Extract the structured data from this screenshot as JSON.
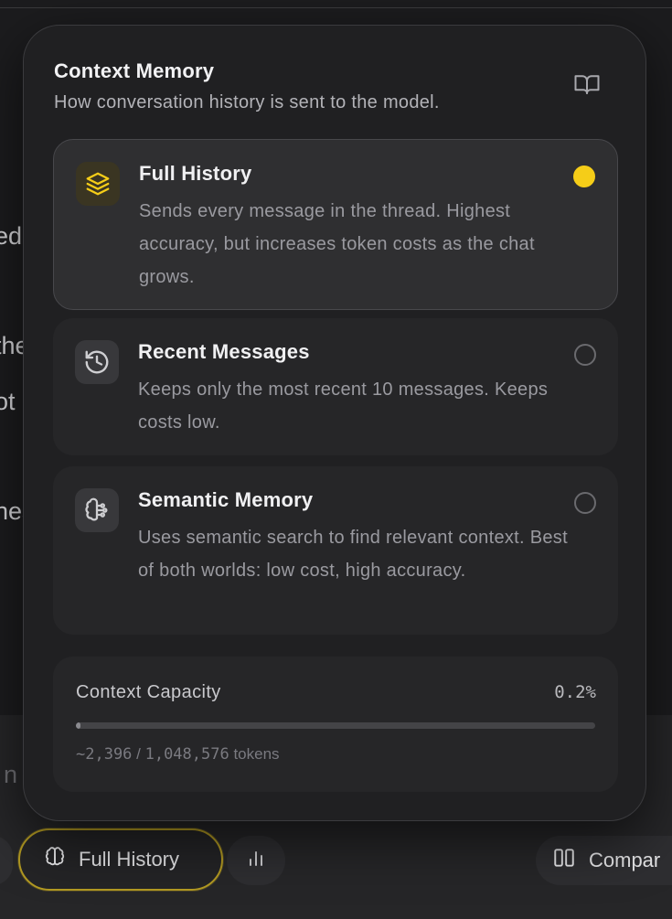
{
  "background": {
    "fragments": [
      "ed,",
      "the",
      "ot",
      "nes"
    ],
    "input_fragment": "n"
  },
  "popover": {
    "title": "Context Memory",
    "subtitle": "How conversation history is sent to the model.",
    "book_icon": "book-open-icon",
    "options": [
      {
        "title": "Full History",
        "description": "Sends every message in the thread. Highest accuracy, but increases token costs as the chat grows.",
        "icon": "layers-icon",
        "selected": true
      },
      {
        "title": "Recent Messages",
        "description": "Keeps only the most recent 10 messages. Keeps costs low.",
        "icon": "history-icon",
        "selected": false
      },
      {
        "title": "Semantic Memory",
        "description": "Uses semantic search to find relevant context. Best of both worlds: low cost, high accuracy.",
        "icon": "brain-icon",
        "selected": false
      }
    ],
    "capacity": {
      "label": "Context Capacity",
      "percent_label": "0.2%",
      "fill_fraction": 0.0023,
      "used": "~2,396",
      "separator": " / ",
      "total": "1,048,576",
      "unit": " tokens"
    }
  },
  "toolbar": {
    "history_button_label": "Full History",
    "history_icon": "brain-icon",
    "stats_icon": "bar-chart-icon",
    "compare_label": "Compar",
    "compare_icon": "columns-icon"
  },
  "colors": {
    "accent": "#f5cd18",
    "selected_border": "#b39a22",
    "panel": "#202022"
  }
}
